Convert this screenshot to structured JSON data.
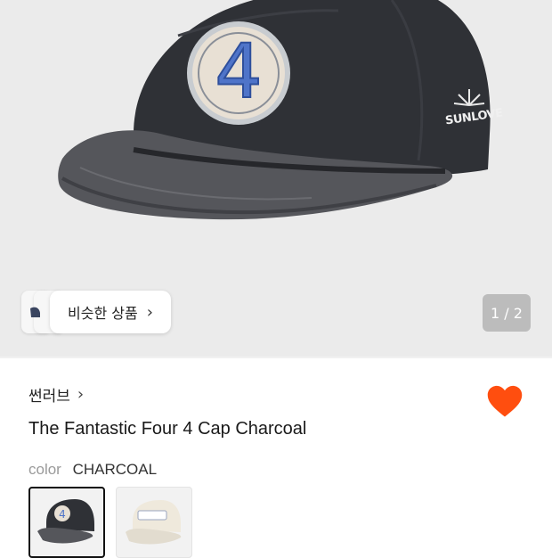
{
  "hero": {
    "similar_label": "비슷한 상품",
    "counter": "1 / 2",
    "cap_brand_mark": "SUNLOVE",
    "patch_number": "4"
  },
  "product": {
    "brand": "썬러브",
    "title": "The Fantastic Four 4 Cap Charcoal",
    "color_label": "color",
    "color_value": "CHARCOAL",
    "liked": true
  },
  "icons": {
    "chevron": "chevron-right-icon",
    "heart": "heart-icon"
  },
  "colors": {
    "heart": "#ff4e0f",
    "hero_bg": "#ebebeb",
    "cap": "#2f3136"
  }
}
